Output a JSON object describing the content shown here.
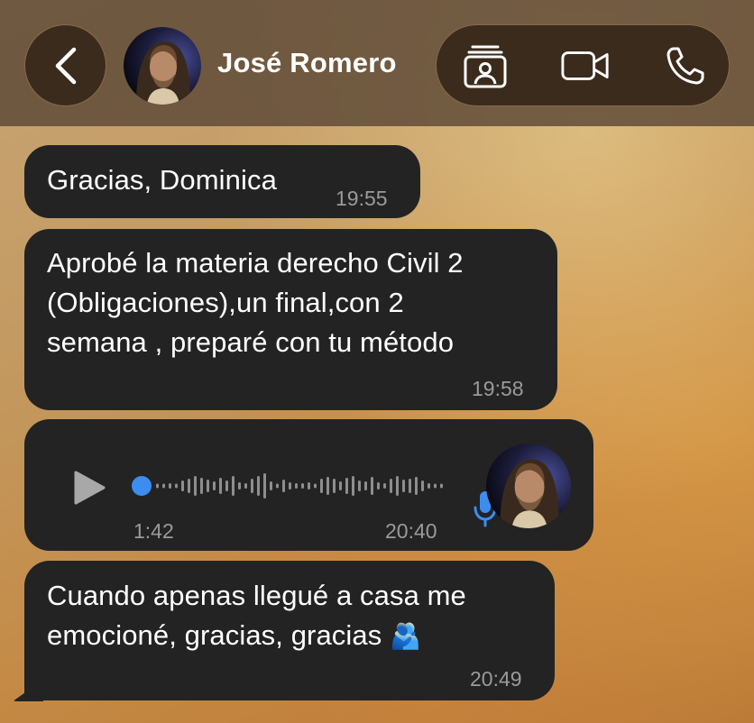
{
  "header": {
    "contact_name": "José Romero",
    "back_icon": "chevron-left-icon",
    "actions": [
      {
        "name": "contact-card",
        "icon": "contact-card-icon"
      },
      {
        "name": "video-call",
        "icon": "video-camera-icon"
      },
      {
        "name": "voice-call",
        "icon": "phone-icon"
      }
    ]
  },
  "messages": [
    {
      "type": "text",
      "text": "Gracias, Dominica",
      "time": "19:55"
    },
    {
      "type": "text",
      "lines": [
        "Aprobé la materia derecho Civil 2",
        "(Obligaciones),un final,con 2",
        "semana , preparé con tu método"
      ],
      "time": "19:58"
    },
    {
      "type": "voice",
      "duration": "1:42",
      "time": "20:40",
      "progress": 0,
      "icon": "microphone-icon"
    },
    {
      "type": "text",
      "lines": [
        "Cuando apenas llegué a casa me",
        "emocioné, gracias, gracias"
      ],
      "emoji": "🫂",
      "time": "20:49"
    }
  ],
  "colors": {
    "bubble": "#232323",
    "header_bg": "#5c4836",
    "play_progress": "#3b8ef0",
    "mic_icon": "#3b8ef0",
    "time_text": "#9a9a9a"
  }
}
